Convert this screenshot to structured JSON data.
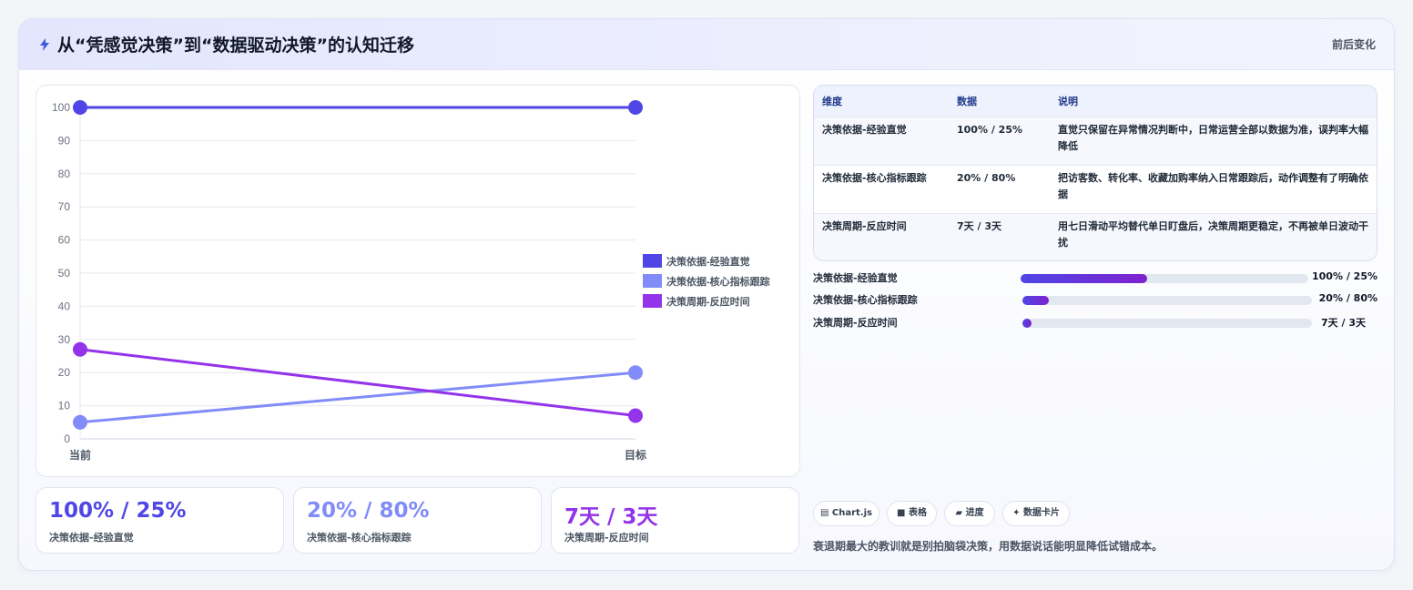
{
  "header": {
    "title": "从“凭感觉决策”到“数据驱动决策”的认知迁移",
    "tag": "前后变化",
    "icon": "lightning-icon"
  },
  "colors": {
    "series1": "#4f46e5",
    "series2": "#818cf8",
    "series3": "#9333ea"
  },
  "chart_data": {
    "type": "line",
    "categories": [
      "当前",
      "目标"
    ],
    "yticks": [
      0,
      10,
      20,
      30,
      40,
      50,
      60,
      70,
      80,
      90,
      100
    ],
    "ylim": [
      0,
      100
    ],
    "grid": true,
    "legend": "right",
    "series": [
      {
        "name": "决策依据-经验直觉",
        "values": [
          100,
          100
        ],
        "color": "#4f46e5"
      },
      {
        "name": "决策依据-核心指标跟踪",
        "values": [
          5,
          20
        ],
        "color": "#818cf8"
      },
      {
        "name": "决策周期-反应时间",
        "values": [
          27,
          7
        ],
        "color": "#9333ea"
      }
    ]
  },
  "stats": [
    {
      "value": "100% / 25%",
      "label": "决策依据-经验直觉",
      "color": "#4f46e5"
    },
    {
      "value": "20% / 80%",
      "label": "决策依据-核心指标跟踪",
      "color": "#818cf8"
    },
    {
      "value": "7天 / 3天",
      "label": "决策周期-反应时间",
      "color": "#9333ea"
    }
  ],
  "table": {
    "headers": [
      "维度",
      "数据",
      "说明"
    ],
    "rows": [
      [
        "决策依据-经验直觉",
        "100% / 25%",
        "直觉只保留在异常情况判断中，日常运营全部以数据为准，误判率大幅降低"
      ],
      [
        "决策依据-核心指标跟踪",
        "20% / 80%",
        "把访客数、转化率、收藏加购率纳入日常跟踪后，动作调整有了明确依据"
      ],
      [
        "决策周期-反应时间",
        "7天 / 3天",
        "用七日滑动平均替代单日盯盘后，决策周期更稳定，不再被单日波动干扰"
      ]
    ]
  },
  "progress": [
    {
      "label": "决策依据-经验直觉",
      "value": "100% / 25%",
      "fill": 0.44
    },
    {
      "label": "决策依据-核心指标跟踪",
      "value": "20% / 80%",
      "fill": 0.09
    },
    {
      "label": "决策周期-反应时间",
      "value": "7天 / 3天",
      "fill": 0.03
    }
  ],
  "chips": [
    {
      "icon": "chart-icon",
      "label": "Chart.js"
    },
    {
      "icon": "table-icon",
      "label": "表格"
    },
    {
      "icon": "progress-icon",
      "label": "进度"
    },
    {
      "icon": "card-icon",
      "label": "数据卡片"
    }
  ],
  "note": "衰退期最大的教训就是别拍脑袋决策，用数据说话能明显降低试错成本。"
}
